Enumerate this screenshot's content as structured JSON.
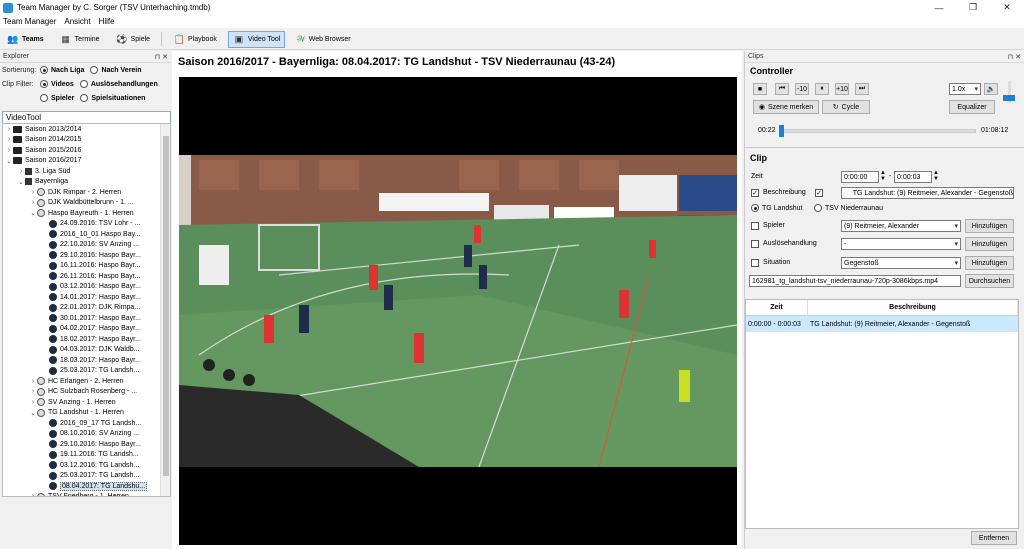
{
  "window": {
    "title": "Team Manager by C. Sorger (TSV Unterhaching.tmdb)",
    "minimize": "—",
    "maximize": "❐",
    "close": "✕"
  },
  "menu": [
    "Team Manager",
    "Ansicht",
    "Hilfe"
  ],
  "toolbar": {
    "teams": "Teams",
    "termine": "Termine",
    "spiele": "Spiele",
    "playbook": "Playbook",
    "videotool": "Video Tool",
    "webbrowser": "Web Browser"
  },
  "explorer": {
    "header": "Explorer",
    "sort_label": "Sortierung:",
    "sort_options": [
      "Nach Liga",
      "Nach Verein"
    ],
    "filter_label": "Clip Filter:",
    "filter_options": [
      "Videos",
      "Auslösehandlungen",
      "Spieler",
      "Spielsituationen"
    ],
    "tree_title": "VideoTool",
    "tree": [
      {
        "label": "Saison 2013/2014",
        "indent": 0,
        "exp": ">",
        "icon": "folder"
      },
      {
        "label": "Saison 2014/2015",
        "indent": 0,
        "exp": ">",
        "icon": "folder"
      },
      {
        "label": "Saison 2015/2016",
        "indent": 0,
        "exp": ">",
        "icon": "folder"
      },
      {
        "label": "Saison 2016/2017",
        "indent": 0,
        "exp": "v",
        "icon": "folder"
      },
      {
        "label": "3. Liga Süd",
        "indent": 1,
        "exp": ">",
        "icon": "league"
      },
      {
        "label": "Bayernliga",
        "indent": 1,
        "exp": "v",
        "icon": "league"
      },
      {
        "label": "DJK Rimpar - 2. Herren",
        "indent": 2,
        "exp": ">",
        "icon": "team"
      },
      {
        "label": "DJK Waldbüttelbrunn - 1. ...",
        "indent": 2,
        "exp": ">",
        "icon": "team"
      },
      {
        "label": "Haspo Bayreuth - 1. Herren",
        "indent": 2,
        "exp": "v",
        "icon": "team"
      },
      {
        "label": "24.09.2016: TSV Lohr - ...",
        "indent": 3,
        "exp": "",
        "icon": "video"
      },
      {
        "label": "2016_10_01 Haspo Bay...",
        "indent": 3,
        "exp": "",
        "icon": "video"
      },
      {
        "label": "22.10.2016: SV Anzing ...",
        "indent": 3,
        "exp": "",
        "icon": "video"
      },
      {
        "label": "29.10.2016: Haspo Bayr...",
        "indent": 3,
        "exp": "",
        "icon": "video"
      },
      {
        "label": "16.11.2016: Haspo Bayr...",
        "indent": 3,
        "exp": "",
        "icon": "video"
      },
      {
        "label": "26.11.2016: Haspo Bayr...",
        "indent": 3,
        "exp": "",
        "icon": "video"
      },
      {
        "label": "03.12.2016: Haspo Bayr...",
        "indent": 3,
        "exp": "",
        "icon": "video"
      },
      {
        "label": "14.01.2017: Haspo Bayr...",
        "indent": 3,
        "exp": "",
        "icon": "video"
      },
      {
        "label": "22.01.2017: DJK Rimpa...",
        "indent": 3,
        "exp": "",
        "icon": "video"
      },
      {
        "label": "30.01.2017: Haspo Bayr...",
        "indent": 3,
        "exp": "",
        "icon": "video"
      },
      {
        "label": "04.02.2017: Haspo Bayr...",
        "indent": 3,
        "exp": "",
        "icon": "video"
      },
      {
        "label": "18.02.2017: Haspo Bayr...",
        "indent": 3,
        "exp": "",
        "icon": "video"
      },
      {
        "label": "04.03.2017: DJK Waldb...",
        "indent": 3,
        "exp": "",
        "icon": "video"
      },
      {
        "label": "18.03.2017: Haspo Bayr...",
        "indent": 3,
        "exp": "",
        "icon": "video"
      },
      {
        "label": "25.03.2017: TG Landsh...",
        "indent": 3,
        "exp": "",
        "icon": "video"
      },
      {
        "label": "HC Erlangen - 2. Herren",
        "indent": 2,
        "exp": ">",
        "icon": "team"
      },
      {
        "label": "HC Sulzbach Rosenberg - ...",
        "indent": 2,
        "exp": ">",
        "icon": "team"
      },
      {
        "label": "SV Anzing - 1. Herren",
        "indent": 2,
        "exp": ">",
        "icon": "team"
      },
      {
        "label": "TG Landshut - 1. Herren",
        "indent": 2,
        "exp": "v",
        "icon": "team"
      },
      {
        "label": "2016_09_17 TG Landsh...",
        "indent": 3,
        "exp": "",
        "icon": "video"
      },
      {
        "label": "08.10.2016: SV Anzing ...",
        "indent": 3,
        "exp": "",
        "icon": "video"
      },
      {
        "label": "29.10.2016: Haspo Bayr...",
        "indent": 3,
        "exp": "",
        "icon": "video"
      },
      {
        "label": "19.11.2016: TG Landsh...",
        "indent": 3,
        "exp": "",
        "icon": "video"
      },
      {
        "label": "03.12.2016: TG Landsh...",
        "indent": 3,
        "exp": "",
        "icon": "video"
      },
      {
        "label": "25.03.2017: TG Landsh...",
        "indent": 3,
        "exp": "",
        "icon": "video"
      },
      {
        "label": "08.04.2017: TG Landshu...",
        "indent": 3,
        "exp": "",
        "icon": "video",
        "selected": true
      },
      {
        "label": "TSV Friedberg - 1. Herren",
        "indent": 2,
        "exp": ">",
        "icon": "team"
      }
    ]
  },
  "video": {
    "title": "Saison 2016/2017 - Bayernliga:  08.04.2017: TG Landshut - TSV Niederraunau (43-24)"
  },
  "clips": {
    "header": "Clips",
    "controller_title": "Controller",
    "controls": [
      "■",
      "⏮",
      "-10",
      "⏸",
      "+10",
      "⏭"
    ],
    "speed": "1.0x",
    "equalizer": "Equalizer",
    "szene_merken": "Szene merken",
    "cycle": "Cycle",
    "time_start": "00:22",
    "time_end": "01:08:12",
    "clip_title": "Clip",
    "zeit_label": "Zeit",
    "zeit_from": "0:00:00",
    "zeit_sep": "-",
    "zeit_to": "0:00:03",
    "beschreibung_label": "Beschreibung",
    "beschreibung_value": "TG Landshut: (9) Reitmeier, Alexander - Gegenstoß",
    "team_options": [
      "TG Landshut",
      "TSV Niederraunau"
    ],
    "spieler_label": "Spieler",
    "spieler_value": "(9) Reitmeier, Alexander",
    "ausloese_label": "Auslösehandlung",
    "ausloese_value": "-",
    "situation_label": "Situation",
    "situation_value": "Gegenstoß",
    "hinzufuegen": "Hinzufügen",
    "file_value": "162981_tg_landshut-tsv_niederraunau-720p-3086kbps.mp4",
    "durchsuchen": "Durchsuchen",
    "table_headers": [
      "Zeit",
      "Beschreibung"
    ],
    "table_rows": [
      {
        "zeit": "0:00:00 - 0:00:03",
        "beschreibung": "TG Landshut: (9) Reitmeier, Alexander - Gegenstoß"
      }
    ],
    "entfernen": "Entfernen"
  }
}
